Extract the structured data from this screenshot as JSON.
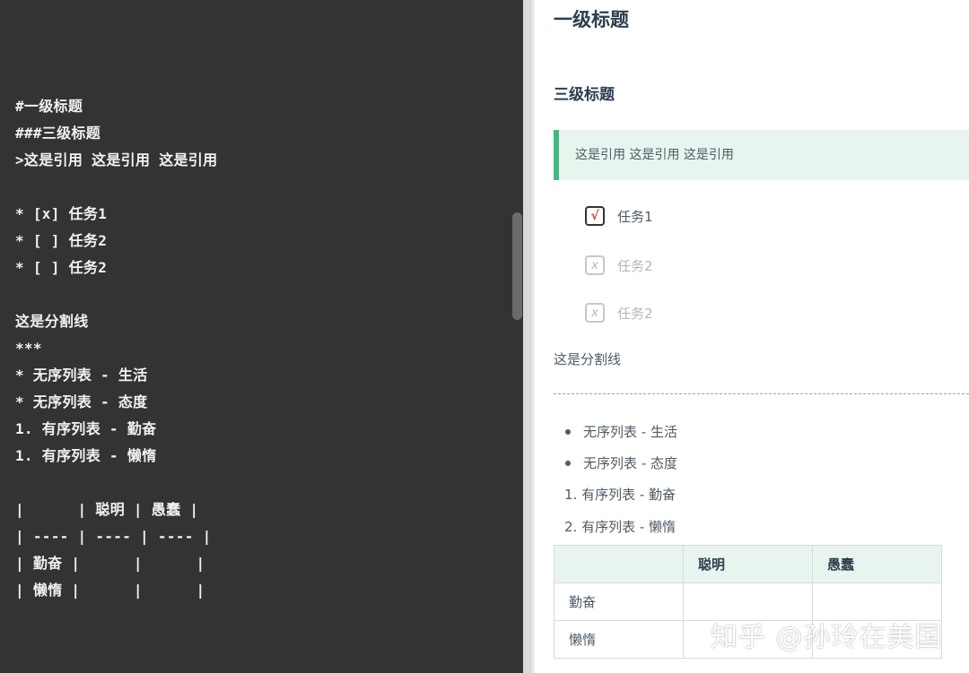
{
  "editor": {
    "lines": [
      "#一级标题",
      "###三级标题",
      ">这是引用 这是引用 这是引用",
      "",
      "* [x] 任务1",
      "* [ ] 任务2",
      "* [ ] 任务2",
      "",
      "这是分割线",
      "***",
      "* 无序列表 - 生活",
      "* 无序列表 - 态度",
      "1. 有序列表 - 勤奋",
      "1. 有序列表 - 懒惰",
      "",
      "|      | 聪明 | 愚蠢 |",
      "| ---- | ---- | ---- |",
      "| 勤奋 |      |      |",
      "| 懒惰 |      |      |"
    ]
  },
  "preview": {
    "h1": "一级标题",
    "h3": "三级标题",
    "quote": "这是引用 这是引用 这是引用",
    "tasks": [
      {
        "mark": "√",
        "label": "任务1",
        "done": true
      },
      {
        "mark": "x",
        "label": "任务2",
        "done": false
      },
      {
        "mark": "x",
        "label": "任务2",
        "done": false
      }
    ],
    "divider_text": "这是分割线",
    "unordered": [
      "无序列表 - 生活",
      "无序列表 - 态度"
    ],
    "ordered": [
      "1. 有序列表 - 勤奋",
      "2. 有序列表 - 懒惰"
    ],
    "table": {
      "headers": [
        "",
        "聪明",
        "愚蠢"
      ],
      "rows": [
        [
          "勤奋",
          "",
          ""
        ],
        [
          "懒惰",
          "",
          ""
        ]
      ]
    }
  },
  "watermark": "知乎 @孙玲在美国",
  "colors": {
    "editor_bg": "#333333",
    "accent_green": "#42b983",
    "quote_bg": "#e8f5ef",
    "check_red": "#e53935"
  }
}
